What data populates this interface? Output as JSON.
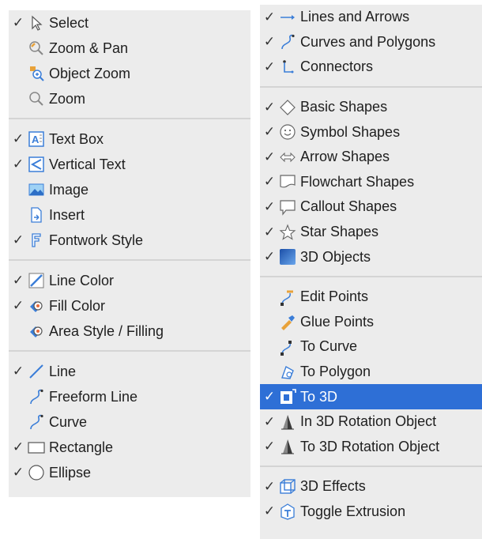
{
  "left_menu": {
    "groups": [
      [
        {
          "label": "Select",
          "checked": true,
          "icon": "select-arrow-icon"
        },
        {
          "label": "Zoom & Pan",
          "checked": false,
          "icon": "zoom-pan-icon"
        },
        {
          "label": "Object Zoom",
          "checked": false,
          "icon": "object-zoom-icon"
        },
        {
          "label": "Zoom",
          "checked": false,
          "icon": "zoom-icon"
        }
      ],
      [
        {
          "label": "Text Box",
          "checked": true,
          "icon": "text-box-icon"
        },
        {
          "label": "Vertical Text",
          "checked": true,
          "icon": "vertical-text-icon"
        },
        {
          "label": "Image",
          "checked": false,
          "icon": "image-icon"
        },
        {
          "label": "Insert",
          "checked": false,
          "icon": "insert-icon"
        },
        {
          "label": "Fontwork Style",
          "checked": true,
          "icon": "fontwork-icon"
        }
      ],
      [
        {
          "label": "Line Color",
          "checked": true,
          "icon": "line-color-icon"
        },
        {
          "label": "Fill Color",
          "checked": true,
          "icon": "fill-color-icon"
        },
        {
          "label": "Area Style / Filling",
          "checked": false,
          "icon": "area-style-icon"
        }
      ],
      [
        {
          "label": "Line",
          "checked": true,
          "icon": "line-icon"
        },
        {
          "label": "Freeform Line",
          "checked": false,
          "icon": "freeform-line-icon"
        },
        {
          "label": "Curve",
          "checked": false,
          "icon": "curve-icon"
        },
        {
          "label": "Rectangle",
          "checked": true,
          "icon": "rectangle-icon"
        },
        {
          "label": "Ellipse",
          "checked": true,
          "icon": "ellipse-icon"
        }
      ]
    ]
  },
  "right_menu": {
    "groups": [
      [
        {
          "label": "Lines and Arrows",
          "checked": true,
          "icon": "line-arrow-icon"
        },
        {
          "label": "Curves and Polygons",
          "checked": true,
          "icon": "curve-polygon-icon"
        },
        {
          "label": "Connectors",
          "checked": true,
          "icon": "connector-icon"
        }
      ],
      [
        {
          "label": "Basic Shapes",
          "checked": true,
          "icon": "diamond-icon"
        },
        {
          "label": "Symbol Shapes",
          "checked": true,
          "icon": "smiley-icon"
        },
        {
          "label": "Arrow Shapes",
          "checked": true,
          "icon": "double-arrow-icon"
        },
        {
          "label": "Flowchart Shapes",
          "checked": true,
          "icon": "flowchart-icon"
        },
        {
          "label": "Callout Shapes",
          "checked": true,
          "icon": "callout-icon"
        },
        {
          "label": "Star Shapes",
          "checked": true,
          "icon": "star-icon"
        },
        {
          "label": "3D Objects",
          "checked": true,
          "icon": "cube-icon"
        }
      ],
      [
        {
          "label": "Edit Points",
          "checked": false,
          "icon": "edit-points-icon"
        },
        {
          "label": "Glue Points",
          "checked": false,
          "icon": "glue-points-icon"
        },
        {
          "label": "To Curve",
          "checked": false,
          "icon": "to-curve-icon"
        },
        {
          "label": "To Polygon",
          "checked": false,
          "icon": "to-polygon-icon"
        },
        {
          "label": "To 3D",
          "checked": true,
          "icon": "to-3d-icon",
          "highlighted": true
        },
        {
          "label": "In 3D Rotation Object",
          "checked": true,
          "icon": "rotation-object-icon"
        },
        {
          "label": "To 3D Rotation Object",
          "checked": true,
          "icon": "rotation-object-icon"
        }
      ],
      [
        {
          "label": "3D Effects",
          "checked": true,
          "icon": "3d-effects-icon"
        },
        {
          "label": "Toggle Extrusion",
          "checked": true,
          "icon": "extrusion-icon"
        }
      ]
    ]
  },
  "check_mark": "✓",
  "colors": {
    "menu_bg": "#ececec",
    "separator": "#d4d4d4",
    "highlight": "#2e6fd6",
    "icon_blue": "#3b7ed8",
    "icon_orange": "#e8a23a"
  }
}
